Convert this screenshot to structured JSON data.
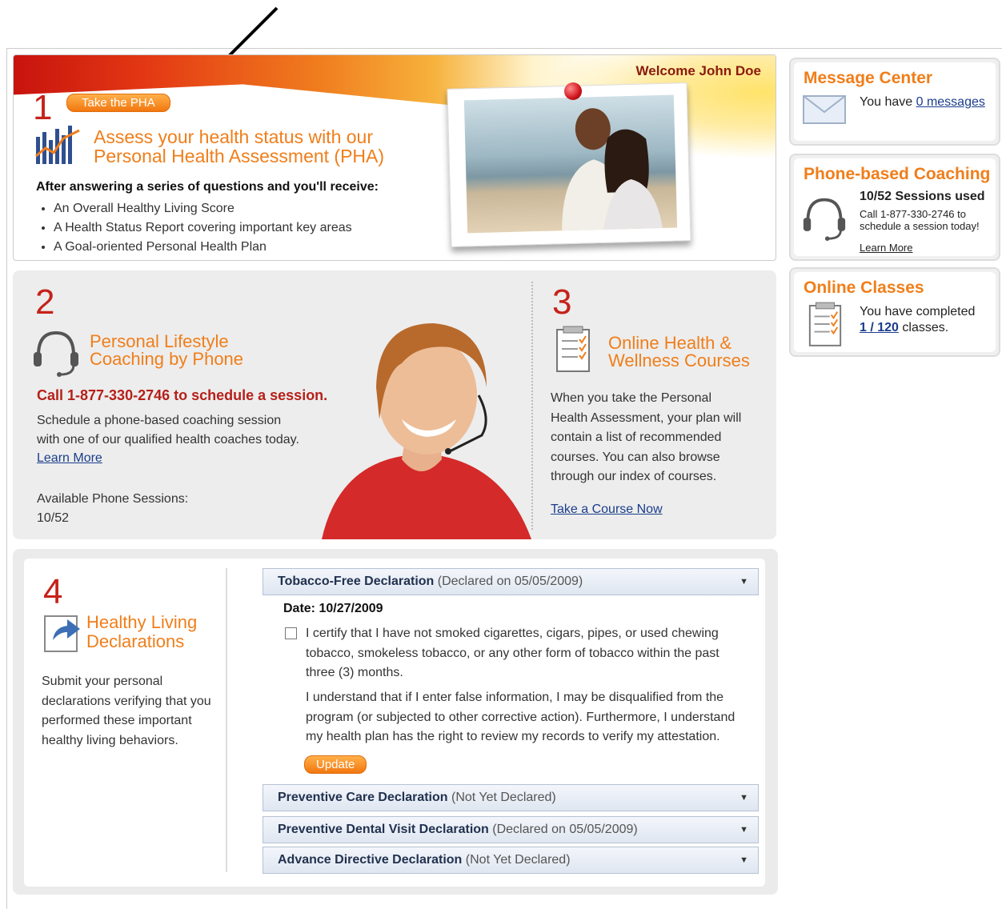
{
  "header": {
    "welcome": "Welcome John Doe"
  },
  "step1": {
    "number": "1",
    "button": "Take the PHA",
    "title_line1": "Assess your health status with our",
    "title_line2": "Personal Health Assessment (PHA)",
    "intro": "After answering a series of questions and you'll receive:",
    "bullets": [
      "An Overall Healthy Living Score",
      "A Health Status Report covering important key areas",
      "A Goal-oriented Personal Health Plan"
    ]
  },
  "step2": {
    "number": "2",
    "title_line1": "Personal Lifestyle",
    "title_line2": "Coaching by Phone",
    "call": "Call 1-877-330-2746 to schedule a session.",
    "body_line1": "Schedule a phone-based coaching session",
    "body_line2": "with one of our qualified health coaches today.",
    "learn_more": "Learn More",
    "available_label": "Available Phone Sessions:",
    "available_value": "10/52"
  },
  "step3": {
    "number": "3",
    "title_line1": "Online Health &",
    "title_line2": "Wellness Courses",
    "body": [
      "When you take the Personal",
      "Health Assessment, your plan will",
      "contain a list of recommended",
      "courses. You can also browse",
      "through our index of courses."
    ],
    "link": "Take a Course Now"
  },
  "step4": {
    "number": "4",
    "title_line1": "Healthy Living",
    "title_line2": "Declarations",
    "body": [
      "Submit your personal",
      "declarations verifying that you",
      "performed these important",
      "healthy living behaviors."
    ],
    "declarations": [
      {
        "name": "Tobacco-Free Declaration",
        "status": "(Declared on 05/05/2009)"
      },
      {
        "name": "Preventive Care Declaration",
        "status": "(Not Yet Declared)"
      },
      {
        "name": "Preventive Dental Visit Declaration",
        "status": "(Declared on 05/05/2009)"
      },
      {
        "name": "Advance Directive Declaration",
        "status": "(Not Yet Declared)"
      }
    ],
    "date": "Date: 10/27/2009",
    "certify": [
      "I certify that I have not smoked cigarettes, cigars, pipes, or used chewing",
      "tobacco, smokeless tobacco, or any other form of tobacco within the past",
      "three (3) months."
    ],
    "understand": [
      "I understand that if I enter false information, I may be disqualified from the",
      "program (or subjected to other corrective action). Furthermore, I understand",
      "my health plan has the right to review my records to verify my attestation."
    ],
    "update": "Update"
  },
  "sidebar": {
    "message_center": {
      "title": "Message Center",
      "text": "You have",
      "link": "0 messages"
    },
    "coaching": {
      "title": "Phone-based Coaching",
      "sessions": "10/52 Sessions used",
      "call_line1": "Call 1-877-330-2746 to",
      "call_line2": "schedule a session today!",
      "learn_more": "Learn More"
    },
    "classes": {
      "title": "Online Classes",
      "line1": "You have completed",
      "link": "1 / 120",
      "line2_suffix": " classes."
    }
  },
  "colors": {
    "accent_orange": "#f07e1a",
    "step_red": "#c5221a",
    "link_blue": "#1a3d8c"
  }
}
